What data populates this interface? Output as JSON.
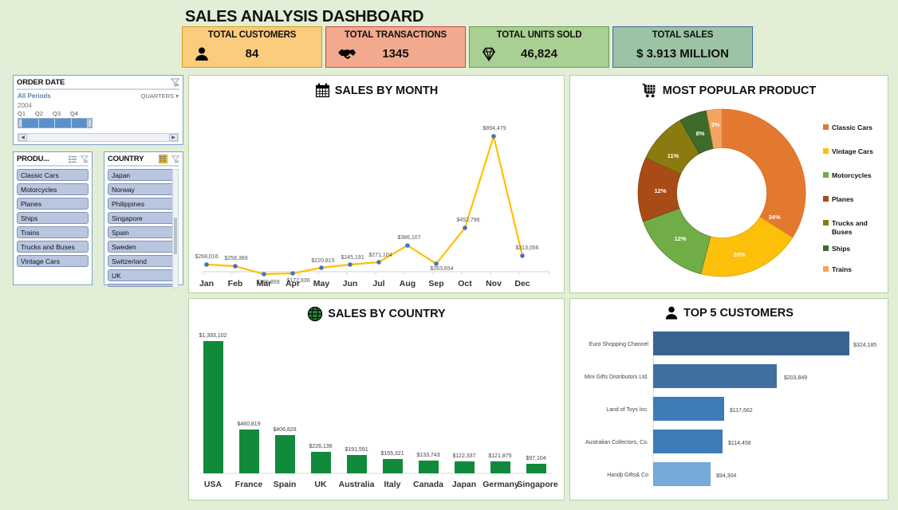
{
  "header": {
    "title": "SALES ANALYSIS DASHBOARD",
    "kpis": [
      {
        "label": "TOTAL CUSTOMERS",
        "value": "84",
        "icon": "person-icon",
        "bg": "#fbcb7e",
        "border": "#d4a017"
      },
      {
        "label": "TOTAL TRANSACTIONS",
        "value": "1345",
        "icon": "handshake-icon",
        "bg": "#f2a98d",
        "border": "#c0504d"
      },
      {
        "label": "TOTAL UNITS SOLD",
        "value": "46,824",
        "icon": "diamond-icon",
        "bg": "#a9cf92",
        "border": "#6a9b4b"
      },
      {
        "label": "TOTAL SALES",
        "value": "$ 3.913 MILLION",
        "icon": "",
        "bg": "#9bc3a4",
        "border": "#3b6a9b"
      }
    ]
  },
  "slicers": {
    "date": {
      "title": "ORDER DATE",
      "all_periods": "All Periods",
      "level": "QUARTERS",
      "year": "2004",
      "quarters": [
        "Q1",
        "Q2",
        "Q3",
        "Q4"
      ],
      "filter_icon": "clear-filter-icon"
    },
    "product": {
      "title": "PRODU...",
      "multiselect_icon": "multiselect-icon",
      "filter_icon": "clear-filter-icon",
      "items": [
        "Classic Cars",
        "Motorcycles",
        "Planes",
        "Ships",
        "Trains",
        "Trucks and Buses",
        "Vintage Cars"
      ]
    },
    "country": {
      "title": "COUNTRY",
      "multiselect_icon": "multiselect-icon",
      "filter_icon": "clear-filter-icon",
      "items": [
        "Japan",
        "Norway",
        "Philippines",
        "Singapore",
        "Spain",
        "Sweden",
        "Switzerland",
        "UK"
      ]
    }
  },
  "panels": {
    "month": {
      "title": "SALES BY MONTH",
      "icon": "calendar-icon"
    },
    "product": {
      "title": "MOST POPULAR PRODUCT",
      "icon": "cart-icon"
    },
    "country": {
      "title": "SALES BY COUNTRY",
      "icon": "globe-icon"
    },
    "customers": {
      "title": "TOP 5 CUSTOMERS",
      "icon": "person-icon"
    }
  },
  "chart_data": [
    {
      "type": "line",
      "title": "SALES BY MONTH",
      "categories": [
        "Jan",
        "Feb",
        "Mar",
        "Apr",
        "May",
        "Jun",
        "Jul",
        "Aug",
        "Sep",
        "Oct",
        "Nov",
        "Dec"
      ],
      "values": [
        268016,
        258389,
        166959,
        172936,
        220815,
        245191,
        271104,
        386107,
        263654,
        452796,
        894479,
        313056
      ],
      "labels": [
        "$268,016",
        "$258,389",
        "$166,959",
        "$172,936",
        "$220,815",
        "$245,191",
        "$271,104",
        "$386,107",
        "$263,654",
        "$452,796",
        "$894,479",
        "$313,056"
      ],
      "line_color": "#ffc000",
      "marker_color": "#4472c4",
      "xlabel": "",
      "ylabel": "",
      "ylim": [
        0,
        950000
      ],
      "grid": false,
      "legend": "none"
    },
    {
      "type": "pie",
      "title": "MOST POPULAR PRODUCT",
      "donut": true,
      "categories": [
        "Classic Cars",
        "Vintage Cars",
        "Motorcycles",
        "Planes",
        "Trucks and Buses",
        "Ships",
        "Trains"
      ],
      "values": [
        34,
        20,
        12,
        12,
        11,
        8,
        3
      ],
      "labels": [
        "34%",
        "20%",
        "12%",
        "12%",
        "11%",
        "8%",
        "3%"
      ],
      "colors": [
        "#e3792e",
        "#fdc00a",
        "#70ad47",
        "#a84b16",
        "#8a7a10",
        "#3e6b2a",
        "#f4a460"
      ],
      "legend": "right"
    },
    {
      "type": "bar",
      "title": "SALES BY COUNTRY",
      "categories": [
        "USA",
        "France",
        "Spain",
        "UK",
        "Australia",
        "Italy",
        "Canada",
        "Japan",
        "Germany",
        "Singapore"
      ],
      "values": [
        1393102,
        460819,
        406828,
        226136,
        191591,
        155321,
        133743,
        122337,
        121875,
        97104
      ],
      "labels": [
        "$1,393,102",
        "$460,819",
        "$406,828",
        "$226,136",
        "$191,591",
        "$155,321",
        "$133,743",
        "$122,337",
        "$121,875",
        "$97,104"
      ],
      "bar_color": "#128a3c",
      "xlabel": "",
      "ylabel": "",
      "ylim": [
        0,
        1450000
      ],
      "grid": false,
      "legend": "none"
    },
    {
      "type": "bar",
      "orientation": "horizontal",
      "title": "TOP 5 CUSTOMERS",
      "categories": [
        "Euro Shopping Channel",
        "Mini Gifts Distributors Ltd.",
        "Land of Toys Inc.",
        "Australian Collectors, Co.",
        "Handji Gifts& Co"
      ],
      "values": [
        324185,
        203849,
        117662,
        114458,
        94304
      ],
      "labels": [
        "$324,185",
        "$203,849",
        "$117,662",
        "$114,458",
        "$94,304"
      ],
      "colors": [
        "#3a6490",
        "#416f9f",
        "#3d7cb8",
        "#3d7cb8",
        "#74a9d8"
      ],
      "xlabel": "",
      "ylabel": "",
      "xlim": [
        0,
        360000
      ],
      "grid": false,
      "legend": "none"
    }
  ]
}
